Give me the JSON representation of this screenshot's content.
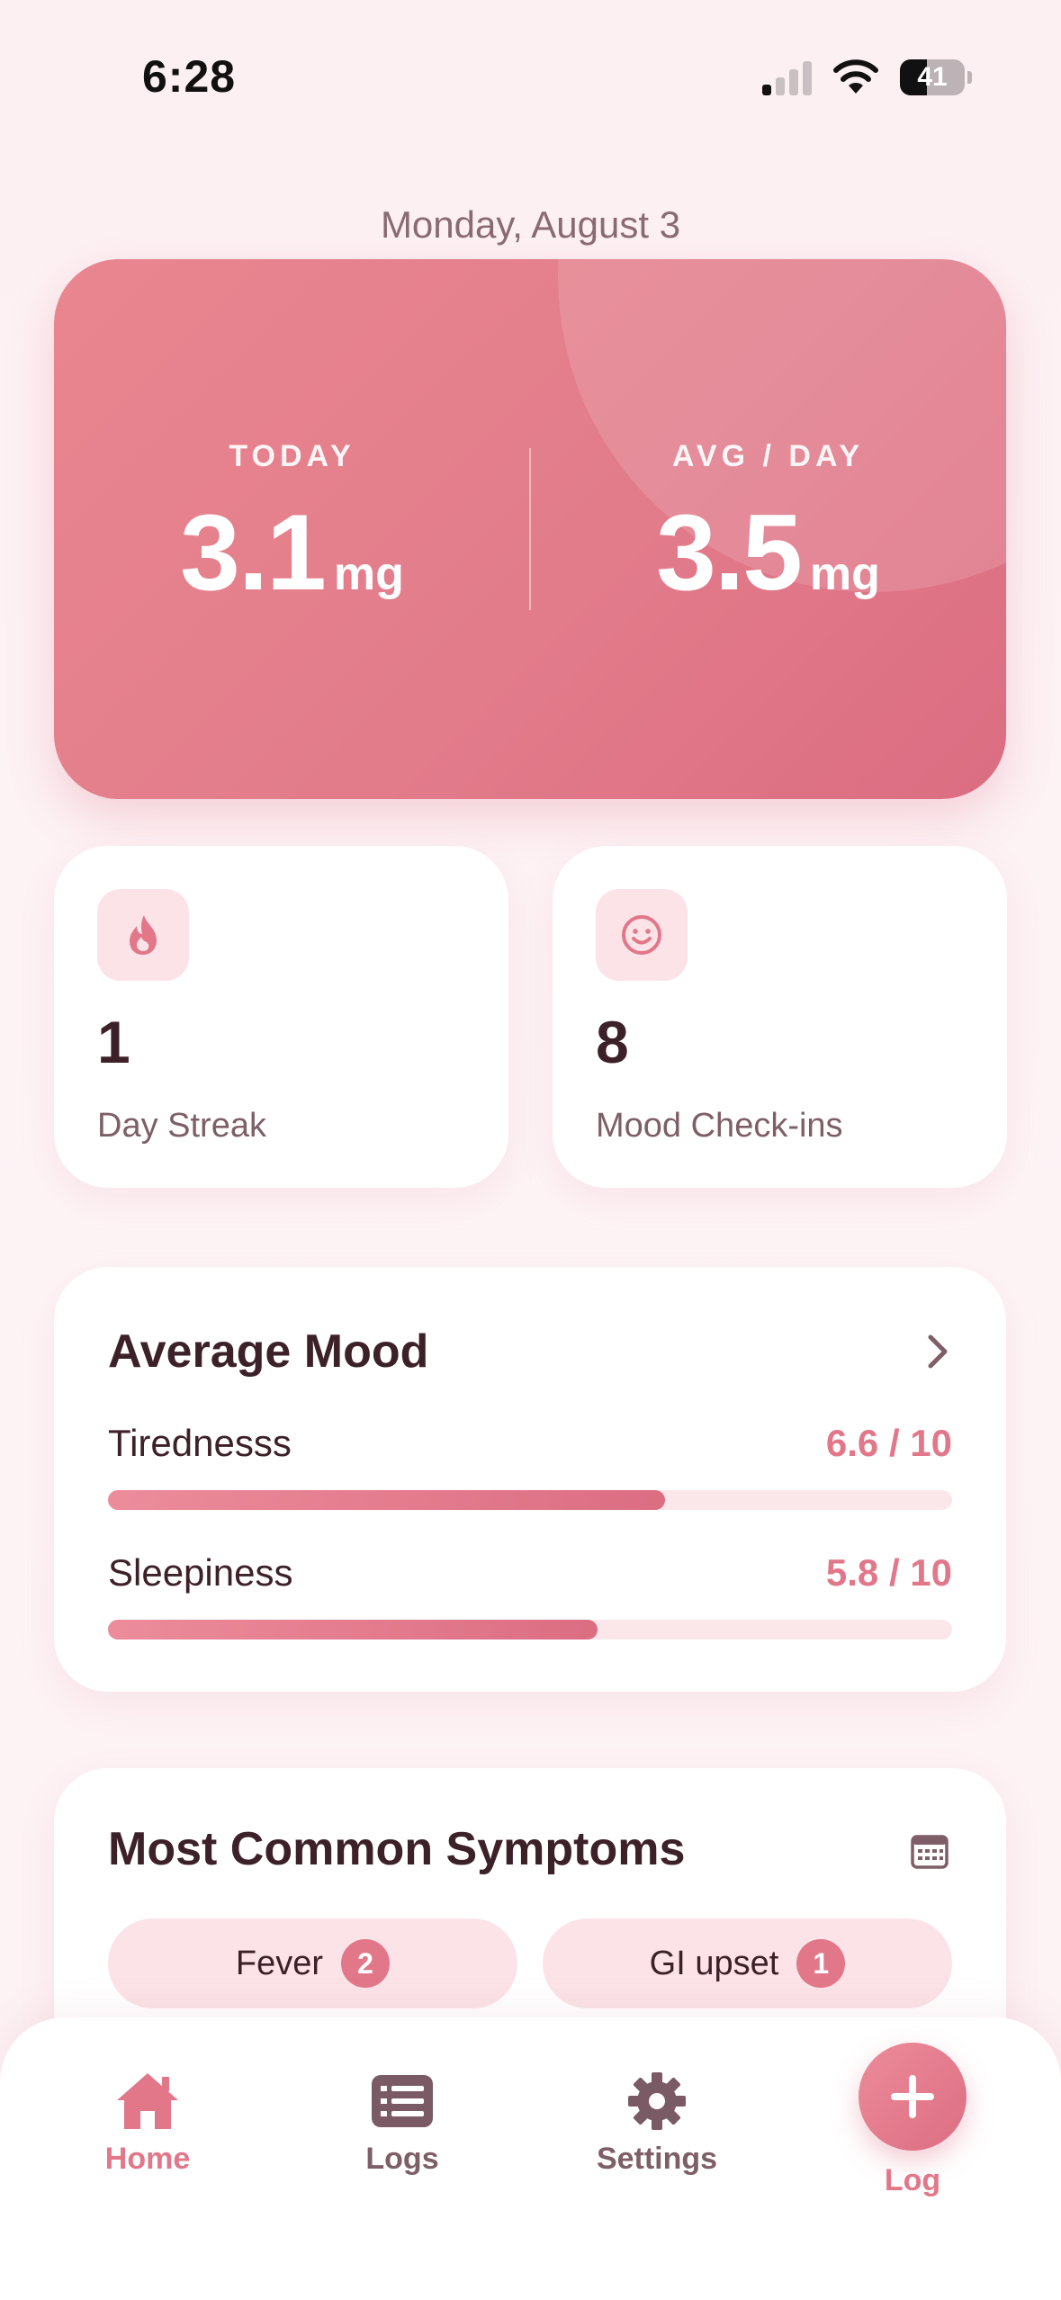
{
  "status_bar": {
    "time": "6:28",
    "battery": "41",
    "battery_level": 0.41
  },
  "date": "Monday, August 3",
  "hero": {
    "today_label": "TODAY",
    "today_value": "3.1",
    "today_unit": "mg",
    "avg_label": "AVG / DAY",
    "avg_value": "3.5",
    "avg_unit": "mg"
  },
  "streak": {
    "value": "1",
    "label": "Day Streak",
    "icon": "flame-icon"
  },
  "mood_checkins": {
    "value": "8",
    "label": "Mood Check-ins",
    "icon": "smiley-icon"
  },
  "average_mood": {
    "title": "Average Mood",
    "items": [
      {
        "label": "Tirednesss",
        "value_text": "6.6 / 10",
        "value": 6.6,
        "max": 10
      },
      {
        "label": "Sleepiness",
        "value_text": "5.8 / 10",
        "value": 5.8,
        "max": 10
      }
    ]
  },
  "symptoms": {
    "title": "Most Common Symptoms",
    "items": [
      {
        "label": "Fever",
        "count": "2"
      },
      {
        "label": "GI upset",
        "count": "1"
      }
    ]
  },
  "tabs": [
    {
      "label": "Home",
      "icon": "home-icon",
      "active": true
    },
    {
      "label": "Logs",
      "icon": "list-icon",
      "active": false
    },
    {
      "label": "Settings",
      "icon": "gear-icon",
      "active": false
    }
  ],
  "fab": {
    "label": "Log",
    "icon": "plus-icon"
  },
  "colors": {
    "accent": "#e2778a",
    "accent_dark": "#dc6d82",
    "text_dark": "#3d2129",
    "background": "#fdf1f3"
  }
}
